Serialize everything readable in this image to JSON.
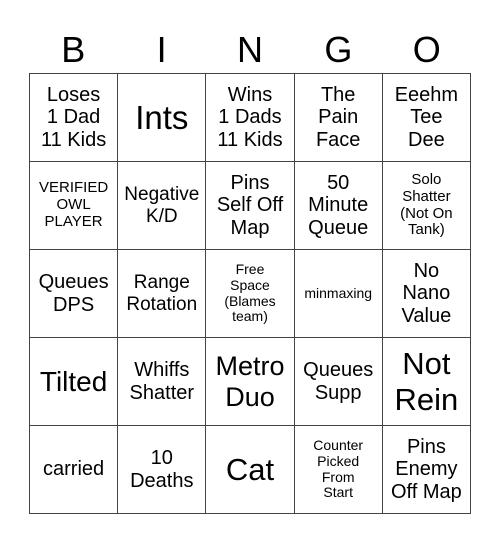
{
  "header": [
    "B",
    "I",
    "N",
    "G",
    "O"
  ],
  "cells": [
    {
      "text": "Loses\n1 Dad\n11 Kids",
      "size": "s20"
    },
    {
      "text": "Ints",
      "size": "s33"
    },
    {
      "text": "Wins\n1 Dads\n11 Kids",
      "size": "s20"
    },
    {
      "text": "The\nPain\nFace",
      "size": "s20"
    },
    {
      "text": "Eeehm\nTee\nDee",
      "size": "s20"
    },
    {
      "text": "VERIFIED\nOWL\nPLAYER",
      "size": "s15"
    },
    {
      "text": "Negative\nK/D",
      "size": "s19"
    },
    {
      "text": "Pins\nSelf Off\nMap",
      "size": "s20"
    },
    {
      "text": "50\nMinute\nQueue",
      "size": "s20"
    },
    {
      "text": "Solo\nShatter\n(Not On\nTank)",
      "size": "s15"
    },
    {
      "text": "Queues\nDPS",
      "size": "s20"
    },
    {
      "text": "Range\nRotation",
      "size": "s19"
    },
    {
      "text": "Free\nSpace\n(Blames\nteam)",
      "size": "s14"
    },
    {
      "text": "minmaxing",
      "size": "s14"
    },
    {
      "text": "No\nNano\nValue",
      "size": "s20"
    },
    {
      "text": "Tilted",
      "size": "s28"
    },
    {
      "text": "Whiffs\nShatter",
      "size": "s20"
    },
    {
      "text": "Metro\nDuo",
      "size": "s27"
    },
    {
      "text": "Queues\nSupp",
      "size": "s20"
    },
    {
      "text": "Not\nRein",
      "size": "s31"
    },
    {
      "text": "carried",
      "size": "s20"
    },
    {
      "text": "10\nDeaths",
      "size": "s20"
    },
    {
      "text": "Cat",
      "size": "s31"
    },
    {
      "text": "Counter\nPicked\nFrom\nStart",
      "size": "s14"
    },
    {
      "text": "Pins\nEnemy\nOff Map",
      "size": "s20"
    }
  ]
}
